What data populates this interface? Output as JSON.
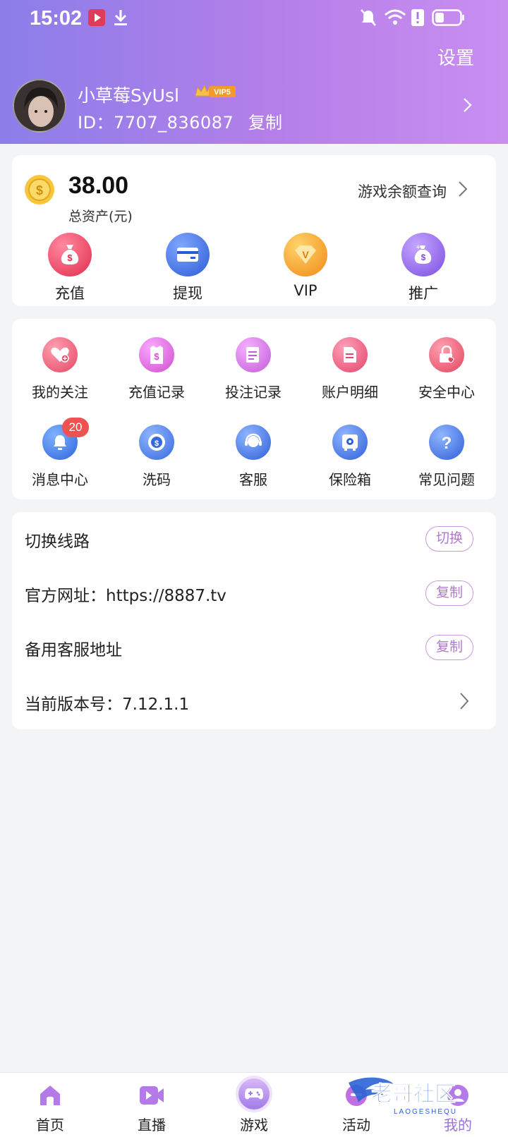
{
  "status_bar": {
    "time": "15:02"
  },
  "header": {
    "settings_label": "设置",
    "nickname": "小草莓SyUsl",
    "vip_level": "VIP5",
    "id_text": "ID：7707_836087",
    "copy_label": "复制"
  },
  "wallet": {
    "balance": "38.00",
    "balance_label": "总资产(元)",
    "query_label": "游戏余额查询",
    "actions": [
      {
        "label": "充值",
        "icon": "money-bag-icon",
        "color": "#e93b57"
      },
      {
        "label": "提现",
        "icon": "card-icon",
        "color": "#3d6fe0"
      },
      {
        "label": "VIP",
        "icon": "vip-gem-icon",
        "color": "#f39a1c"
      },
      {
        "label": "推广",
        "icon": "promo-bag-icon",
        "color": "#8b5ce6"
      }
    ]
  },
  "features": {
    "items": [
      {
        "label": "我的关注",
        "icon": "heart-follow-icon"
      },
      {
        "label": "充值记录",
        "icon": "recharge-record-icon"
      },
      {
        "label": "投注记录",
        "icon": "bet-record-icon"
      },
      {
        "label": "账户明细",
        "icon": "account-detail-icon"
      },
      {
        "label": "安全中心",
        "icon": "security-lock-icon"
      },
      {
        "label": "消息中心",
        "icon": "message-bell-icon",
        "badge": "20"
      },
      {
        "label": "洗码",
        "icon": "chip-icon"
      },
      {
        "label": "客服",
        "icon": "customer-service-icon"
      },
      {
        "label": "保险箱",
        "icon": "safe-box-icon"
      },
      {
        "label": "常见问题",
        "icon": "question-icon"
      }
    ]
  },
  "settings_list": {
    "switch_route_label": "切换线路",
    "switch_btn": "切换",
    "official_site_label": "官方网址：https://8887.tv",
    "official_copy_btn": "复制",
    "backup_service_label": "备用客服地址",
    "backup_copy_btn": "复制",
    "version_label": "当前版本号：7.12.1.1"
  },
  "tabbar": {
    "tabs": [
      {
        "label": "首页",
        "icon": "home-icon"
      },
      {
        "label": "直播",
        "icon": "live-video-icon"
      },
      {
        "label": "游戏",
        "icon": "gamepad-icon"
      },
      {
        "label": "活动",
        "icon": "activity-icon"
      },
      {
        "label": "我的",
        "icon": "profile-icon",
        "active": true
      }
    ]
  },
  "watermark": {
    "text": "老哥社区",
    "subtext": "LAOGESHEQU"
  }
}
